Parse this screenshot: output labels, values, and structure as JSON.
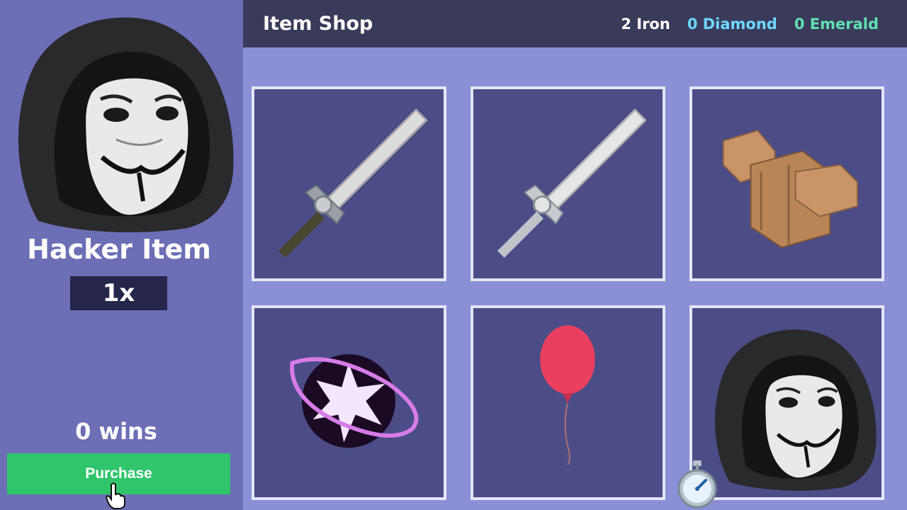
{
  "selected_item": {
    "name": "Hacker Item",
    "quantity": "1x",
    "price": "0 wins",
    "purchase_label": "Purchase"
  },
  "header": {
    "title": "Item Shop",
    "currencies": {
      "iron": "2 Iron",
      "diamond": "0 Diamond",
      "emerald": "0 Emerald"
    }
  },
  "colors": {
    "panel_bg": "#6c6fb6",
    "header_bg": "#3a3a5a",
    "grid_bg": "#8a8fd6",
    "slot_bg": "#4c4d86",
    "purchase_button": "#30c46b",
    "diamond": "#6fd6ff",
    "emerald": "#61e0b0"
  },
  "shop_items": [
    {
      "icon": "stone-sword-icon"
    },
    {
      "icon": "iron-sword-icon"
    },
    {
      "icon": "wood-blocks-icon"
    },
    {
      "icon": "void-orb-icon"
    },
    {
      "icon": "balloon-icon"
    },
    {
      "icon": "hacker-mask-icon"
    }
  ]
}
